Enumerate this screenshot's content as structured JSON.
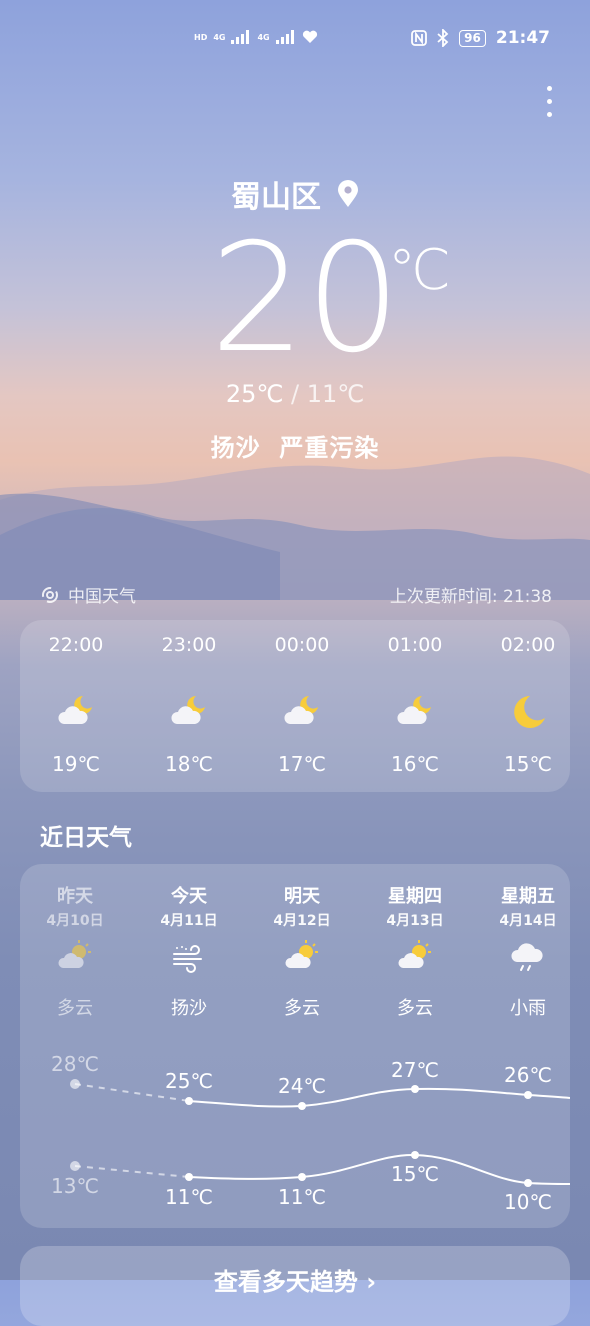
{
  "status_bar": {
    "left_indicators": [
      "HD",
      "4G",
      "4G"
    ],
    "battery": "96",
    "time": "21:47"
  },
  "location": "蜀山区",
  "current": {
    "temp": "20",
    "unit": "℃",
    "high": "25℃",
    "separator": "/",
    "low": "11℃",
    "condition": "扬沙",
    "air_quality": "严重污染"
  },
  "source": "中国天气",
  "updated_label": "上次更新时间:",
  "updated_time": "21:38",
  "hourly": [
    {
      "time": "22:00",
      "icon": "cloudy-night-icon",
      "temp": "19℃"
    },
    {
      "time": "23:00",
      "icon": "cloudy-night-icon",
      "temp": "18℃"
    },
    {
      "time": "00:00",
      "icon": "cloudy-night-icon",
      "temp": "17℃"
    },
    {
      "time": "01:00",
      "icon": "cloudy-night-icon",
      "temp": "16℃"
    },
    {
      "time": "02:00",
      "icon": "moon-icon",
      "temp": "15℃"
    }
  ],
  "daily_title": "近日天气",
  "daily": [
    {
      "name": "昨天",
      "date": "4月10日",
      "icon": "partly-cloudy-icon",
      "cond": "多云",
      "high": "28℃",
      "low": "13℃"
    },
    {
      "name": "今天",
      "date": "4月11日",
      "icon": "sand-wind-icon",
      "cond": "扬沙",
      "high": "25℃",
      "low": "11℃"
    },
    {
      "name": "明天",
      "date": "4月12日",
      "icon": "partly-cloudy-icon",
      "cond": "多云",
      "high": "24℃",
      "low": "11℃"
    },
    {
      "name": "星期四",
      "date": "4月13日",
      "icon": "partly-cloudy-icon",
      "cond": "多云",
      "high": "27℃",
      "low": "15℃"
    },
    {
      "name": "星期五",
      "date": "4月14日",
      "icon": "light-rain-icon",
      "cond": "小雨",
      "high": "26℃",
      "low": "10℃"
    }
  ],
  "bottom_button": "查看多天趋势 ›"
}
